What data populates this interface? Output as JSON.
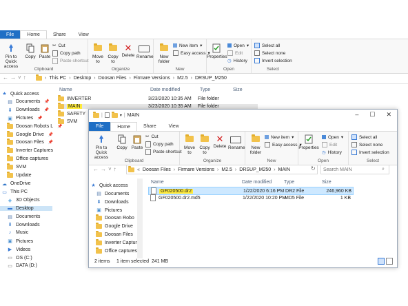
{
  "back": {
    "tabs": [
      "File",
      "Home",
      "Share",
      "View"
    ],
    "clipboard": {
      "pin": "Pin to Quick access",
      "copy": "Copy",
      "paste": "Paste",
      "cut": "Cut",
      "copy_path": "Copy path",
      "paste_shortcut": "Paste shortcut",
      "title": "Clipboard"
    },
    "organize": {
      "move_to": "Move to",
      "copy_to": "Copy to",
      "delete": "Delete",
      "rename": "Rename",
      "title": "Organize"
    },
    "new": {
      "new_folder": "New folder",
      "new_item": "New item",
      "easy_access": "Easy access",
      "title": "New"
    },
    "open": {
      "properties": "Properties",
      "open": "Open",
      "edit": "Edit",
      "history": "History",
      "title": "Open"
    },
    "select": {
      "select_all": "Select all",
      "select_none": "Select none",
      "invert": "Invert selection",
      "title": "Select"
    },
    "breadcrumb": [
      "This PC",
      "Desktop",
      "Doosan Files",
      "Firmare Versions",
      "M2.5",
      "DRSUP_M250"
    ],
    "columns": {
      "name": "Name",
      "date": "Date modified",
      "type": "Type",
      "size": "Size"
    },
    "rows": [
      {
        "name": "INVERTER",
        "date": "3/23/2020 10:35 AM",
        "type": "File folder",
        "highlight": false
      },
      {
        "name": "MAIN",
        "date": "3/23/2020 10:35 AM",
        "type": "File folder",
        "highlight": true
      },
      {
        "name": "SAFETY",
        "date": "",
        "type": "",
        "highlight": false
      },
      {
        "name": "SVM",
        "date": "",
        "type": "",
        "highlight": false
      }
    ],
    "nav": [
      {
        "label": "Quick access",
        "icon": "star-icon",
        "pin": false,
        "level": 0
      },
      {
        "label": "Documents",
        "icon": "documents-icon",
        "pin": true,
        "level": 1
      },
      {
        "label": "Downloads",
        "icon": "downloads-icon",
        "pin": true,
        "level": 1
      },
      {
        "label": "Pictures",
        "icon": "pictures-icon",
        "pin": true,
        "level": 1
      },
      {
        "label": "Doosan Robots L",
        "icon": "folder-icon",
        "pin": true,
        "level": 1
      },
      {
        "label": "Google Drive",
        "icon": "folder-icon",
        "pin": true,
        "level": 1
      },
      {
        "label": "Doosan Files",
        "icon": "folder-icon",
        "pin": true,
        "level": 1
      },
      {
        "label": "Inverter Captures",
        "icon": "folder-icon",
        "pin": false,
        "level": 1
      },
      {
        "label": "Office captures",
        "icon": "folder-icon",
        "pin": false,
        "level": 1
      },
      {
        "label": "SVM",
        "icon": "folder-icon",
        "pin": false,
        "level": 1
      },
      {
        "label": "Update",
        "icon": "folder-icon",
        "pin": false,
        "level": 1
      },
      {
        "label": "OneDrive",
        "icon": "cloud-icon",
        "pin": false,
        "level": 0
      },
      {
        "label": "This PC",
        "icon": "pc-icon",
        "pin": false,
        "level": 0
      },
      {
        "label": "3D Objects",
        "icon": "3d-objects-icon",
        "pin": false,
        "level": 1
      },
      {
        "label": "Desktop",
        "icon": "desktop-icon",
        "pin": false,
        "level": 1,
        "selected": true
      },
      {
        "label": "Documents",
        "icon": "documents-icon",
        "pin": false,
        "level": 1
      },
      {
        "label": "Downloads",
        "icon": "downloads-icon",
        "pin": false,
        "level": 1
      },
      {
        "label": "Music",
        "icon": "music-icon",
        "pin": false,
        "level": 1
      },
      {
        "label": "Pictures",
        "icon": "pictures-icon",
        "pin": false,
        "level": 1
      },
      {
        "label": "Videos",
        "icon": "videos-icon",
        "pin": false,
        "level": 1
      },
      {
        "label": "OS (C:)",
        "icon": "drive-icon",
        "pin": false,
        "level": 1
      },
      {
        "label": "DATA (D:)",
        "icon": "drive-icon",
        "pin": false,
        "level": 1
      }
    ]
  },
  "front": {
    "title": "MAIN",
    "tabs": [
      "File",
      "Home",
      "Share",
      "View"
    ],
    "clipboard": {
      "pin": "Pin to Quick access",
      "copy": "Copy",
      "paste": "Paste",
      "cut": "Cut",
      "copy_path": "Copy path",
      "paste_shortcut": "Paste shortcut",
      "title": "Clipboard"
    },
    "organize": {
      "move_to": "Move to",
      "copy_to": "Copy to",
      "delete": "Delete",
      "rename": "Rename",
      "title": "Organize"
    },
    "new": {
      "new_folder": "New folder",
      "new_item": "New item",
      "easy_access": "Easy access",
      "title": "New"
    },
    "open": {
      "properties": "Properties",
      "open": "Open",
      "edit": "Edit",
      "history": "History",
      "title": "Open"
    },
    "select": {
      "select_all": "Select all",
      "select_none": "Select none",
      "invert": "Invert selection",
      "title": "Select"
    },
    "breadcrumb": [
      "Doosan Files",
      "Firmare Versions",
      "M2.5",
      "DRSUP_M250",
      "MAIN"
    ],
    "search_placeholder": "Search MAIN",
    "columns": {
      "name": "Name",
      "date": "Date modified",
      "type": "Type",
      "size": "Size"
    },
    "rows": [
      {
        "name": "GF020500.dr2",
        "date": "1/22/2020 6:16 PM",
        "type": "DR2 File",
        "size": "246,960 KB",
        "selected": true
      },
      {
        "name": "GF020500.dr2.md5",
        "date": "1/22/2020 10:20 PM",
        "type": "MD5 File",
        "size": "1 KB",
        "selected": false
      }
    ],
    "nav": [
      {
        "label": "Quick access",
        "icon": "star-icon",
        "level": 0
      },
      {
        "label": "Documents",
        "icon": "documents-icon",
        "level": 1
      },
      {
        "label": "Downloads",
        "icon": "downloads-icon",
        "level": 1
      },
      {
        "label": "Pictures",
        "icon": "pictures-icon",
        "level": 1
      },
      {
        "label": "Doosan Robo",
        "icon": "folder-icon",
        "level": 1
      },
      {
        "label": "Google Drive",
        "icon": "folder-icon",
        "level": 1
      },
      {
        "label": "Doosan Files",
        "icon": "folder-icon",
        "level": 1
      },
      {
        "label": "Inverter Capture",
        "icon": "folder-icon",
        "level": 1
      },
      {
        "label": "Office captures",
        "icon": "folder-icon",
        "level": 1
      }
    ],
    "status": {
      "items": "2 items",
      "selected": "1 item selected  241 MB"
    }
  },
  "colors": {
    "accent": "#1f6fc5",
    "highlight": "#ffeb3b",
    "selection": "#cde8ff"
  }
}
